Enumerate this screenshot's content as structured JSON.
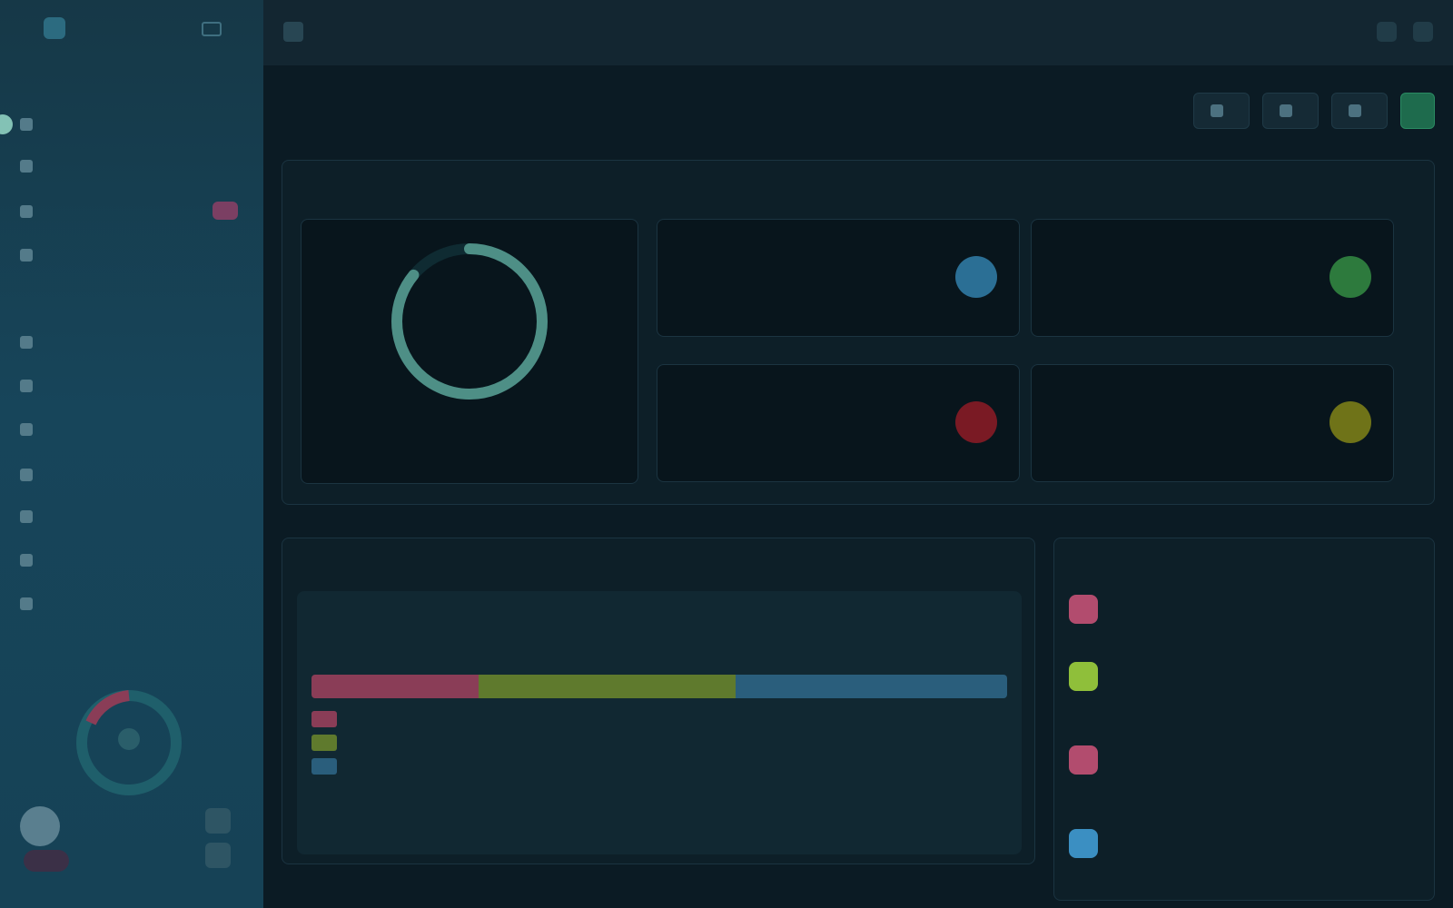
{
  "app": {
    "name": "",
    "breadcrumb": "",
    "breadcrumb_sub": ""
  },
  "sidebar": {
    "section_labels": [
      "",
      ""
    ],
    "items": [
      {
        "label": "",
        "badge": ""
      },
      {
        "label": "",
        "badge": ""
      },
      {
        "label": "",
        "badge": ""
      },
      {
        "label": "",
        "badge": ""
      },
      {
        "label": "",
        "badge": ""
      },
      {
        "label": "",
        "badge": ""
      },
      {
        "label": "",
        "badge": ""
      },
      {
        "label": "",
        "badge": ""
      },
      {
        "label": "",
        "badge": ""
      },
      {
        "label": "",
        "badge": ""
      },
      {
        "label": "",
        "badge": ""
      }
    ],
    "user": {
      "name": ""
    }
  },
  "page": {
    "title": "",
    "actions": [
      "",
      "",
      ""
    ],
    "primary_action": ""
  },
  "summary": {
    "title": "",
    "link": "",
    "donut": {
      "value": "",
      "label": "",
      "caption": "",
      "fraction": 0.86
    },
    "tiles": [
      {
        "value": "",
        "label": "",
        "color": "#2b6f95"
      },
      {
        "value": "",
        "label": "",
        "color": "#2d7a3d"
      },
      {
        "value": "",
        "label": "",
        "color": "#7a1a24"
      },
      {
        "value": "",
        "label": "",
        "color": "#6f7318"
      }
    ]
  },
  "services": {
    "title": "",
    "link": "",
    "total": "",
    "subtitle": "",
    "right_note": "",
    "segments": [
      {
        "name": "",
        "value": 24,
        "color": "#8a3d57"
      },
      {
        "name": "",
        "value": 37,
        "color": "#5f7a2d"
      },
      {
        "name": "",
        "value": 39,
        "color": "#2a5e7c"
      }
    ],
    "footer": ""
  },
  "events": {
    "title": "",
    "link": "",
    "items": [
      {
        "title": "",
        "detail": "",
        "time": "",
        "color": "#b24c6e"
      },
      {
        "title": "",
        "detail": "",
        "time": "",
        "color": "#8fbf3a"
      },
      {
        "title": "",
        "detail": "",
        "time": "",
        "color": "#b24c6e"
      },
      {
        "title": "",
        "detail": "",
        "time": "",
        "color": "#3b8fc2"
      }
    ]
  }
}
